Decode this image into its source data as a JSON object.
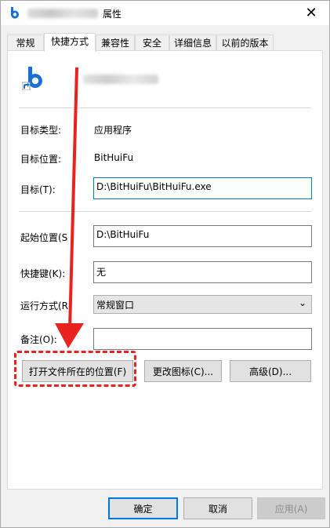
{
  "window": {
    "title_suffix": "属性",
    "close_glyph": "✕"
  },
  "tabs": [
    {
      "label": "常规"
    },
    {
      "label": "快捷方式"
    },
    {
      "label": "兼容性"
    },
    {
      "label": "安全"
    },
    {
      "label": "详细信息"
    },
    {
      "label": "以前的版本"
    }
  ],
  "fields": {
    "target_type": {
      "label": "目标类型:",
      "value": "应用程序"
    },
    "target_location": {
      "label": "目标位置:",
      "value": "BitHuiFu"
    },
    "target": {
      "label": "目标(T):",
      "value": "D:\\BitHuiFu\\BitHuiFu.exe"
    },
    "start_in": {
      "label": "起始位置(S",
      "value": "D:\\BitHuiFu"
    },
    "shortcut_key": {
      "label": "快捷键(K):",
      "value": "无"
    },
    "run": {
      "label": "运行方式(R",
      "value": "常规窗口"
    },
    "comment": {
      "label": "备注(O):",
      "value": ""
    }
  },
  "buttons": {
    "open_location": "打开文件所在的位置(F)",
    "change_icon": "更改图标(C)...",
    "advanced": "高级(D)...",
    "ok": "确定",
    "cancel": "取消",
    "apply": "应用(A)"
  },
  "colors": {
    "annotation": "#e8231f",
    "accent": "#0078d7",
    "app_icon": "#1a6fd6"
  },
  "icons": {
    "app": "bithuifu-app-icon",
    "shortcut_overlay": "shortcut-arrow-icon"
  }
}
